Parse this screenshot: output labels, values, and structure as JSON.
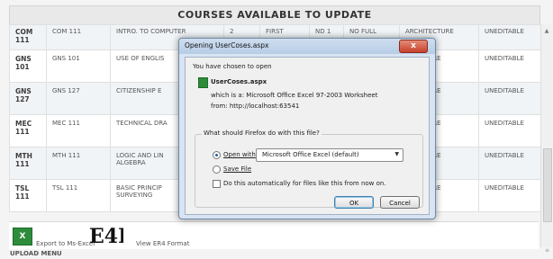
{
  "page_title": "COURSES AVAILABLE TO UPDATE",
  "courses": [
    {
      "code": "COM 111",
      "course_code": "COM 111",
      "title": "INTRO. TO COMPUTER",
      "units": "2",
      "semester": "FIRST",
      "level": "ND 1",
      "status": "NO FULL",
      "department": "ARCHITECTURE",
      "action": "UNEDITABLE"
    },
    {
      "code": "GNS 101",
      "course_code": "GNS 101",
      "title": "USE OF ENGLIS",
      "department": "HITECTURE",
      "action": "UNEDITABLE"
    },
    {
      "code": "GNS 127",
      "course_code": "GNS 127",
      "title": "CITIZENSHIP E",
      "department": "HITECTURE",
      "action": "UNEDITABLE"
    },
    {
      "code": "MEC 111",
      "course_code": "MEC 111",
      "title": "TECHNICAL DRA",
      "department": "HITECTURE",
      "action": "UNEDITABLE"
    },
    {
      "code": "MTH 111",
      "course_code": "MTH 111",
      "title": "LOGIC AND LIN",
      "title2": "ALGEBRA",
      "department": "HITECTURE",
      "action": "UNEDITABLE"
    },
    {
      "code": "TSL 111",
      "course_code": "TSL 111",
      "title": "BASIC PRINCIP",
      "title2": "SURVEYING",
      "department": "HITECTURE",
      "action": "UNEDITABLE"
    }
  ],
  "export": {
    "excel_label": "Export to Ms-Excel",
    "er4_logo": "E4R",
    "er4_label": "View ER4 Format"
  },
  "upload_menu": "UPLOAD MENU",
  "dialog": {
    "title": "Opening UserCoses.aspx",
    "close_glyph": "x",
    "intro": "You have chosen to open",
    "filename": "UserCoses.aspx",
    "which_is": "which is a:  Microsoft Office Excel 97-2003 Worksheet",
    "from": "from:  http://localhost:63541",
    "question": "What should Firefox do with this file?",
    "open_with_label": "Open with",
    "open_with_value": "Microsoft Office Excel (default)",
    "save_file_label": "Save File",
    "auto_label": "Do this automatically for files like this from now on.",
    "ok_label": "OK",
    "cancel_label": "Cancel"
  },
  "colors": {
    "excel_green": "#2d8c3a",
    "close_red": "#c7422a",
    "dialog_frame": "#d8e4f2"
  }
}
